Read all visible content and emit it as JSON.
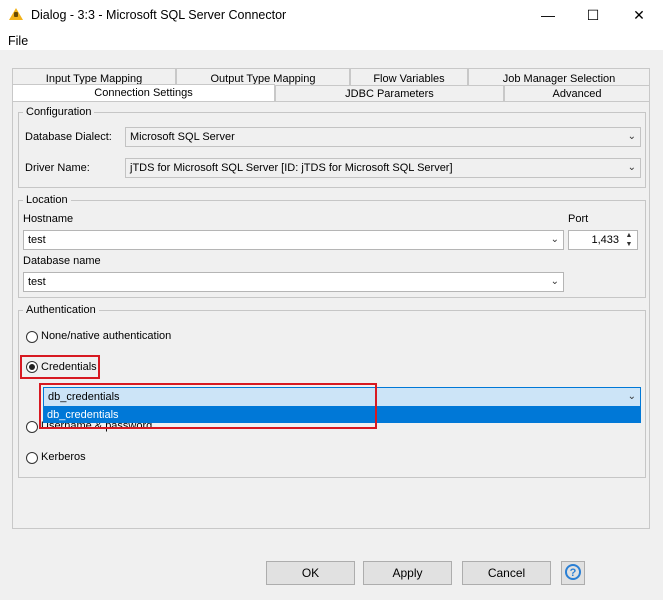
{
  "window": {
    "title": "Dialog - 3:3 - Microsoft SQL Server Connector",
    "minimize": "—",
    "maximize": "☐",
    "close": "✕"
  },
  "menu": {
    "file": "File"
  },
  "tabs": {
    "back_row": [
      "Input Type Mapping",
      "Output Type Mapping",
      "Flow Variables",
      "Job Manager Selection"
    ],
    "front_row": [
      "Connection Settings",
      "JDBC Parameters",
      "Advanced"
    ],
    "active": "Connection Settings"
  },
  "configuration": {
    "legend": "Configuration",
    "dialect_label": "Database Dialect:",
    "dialect_value": "Microsoft SQL Server",
    "driver_label": "Driver Name:",
    "driver_value": "jTDS for Microsoft SQL Server [ID: jTDS for Microsoft SQL Server]"
  },
  "location": {
    "legend": "Location",
    "hostname_label": "Hostname",
    "hostname_value": "test",
    "port_label": "Port",
    "port_value": "1,433",
    "dbname_label": "Database name",
    "dbname_value": "test"
  },
  "authentication": {
    "legend": "Authentication",
    "options": [
      "None/native authentication",
      "Credentials",
      "Username & password",
      "Kerberos"
    ],
    "selected": "Credentials",
    "credentials_value": "db_credentials",
    "dropdown_items": [
      "db_credentials"
    ]
  },
  "buttons": {
    "ok": "OK",
    "apply": "Apply",
    "cancel": "Cancel",
    "help": "?"
  },
  "colors": {
    "highlight_red": "#d71921",
    "selection_blue": "#0078d7",
    "combo_focus": "#cce4f7"
  }
}
